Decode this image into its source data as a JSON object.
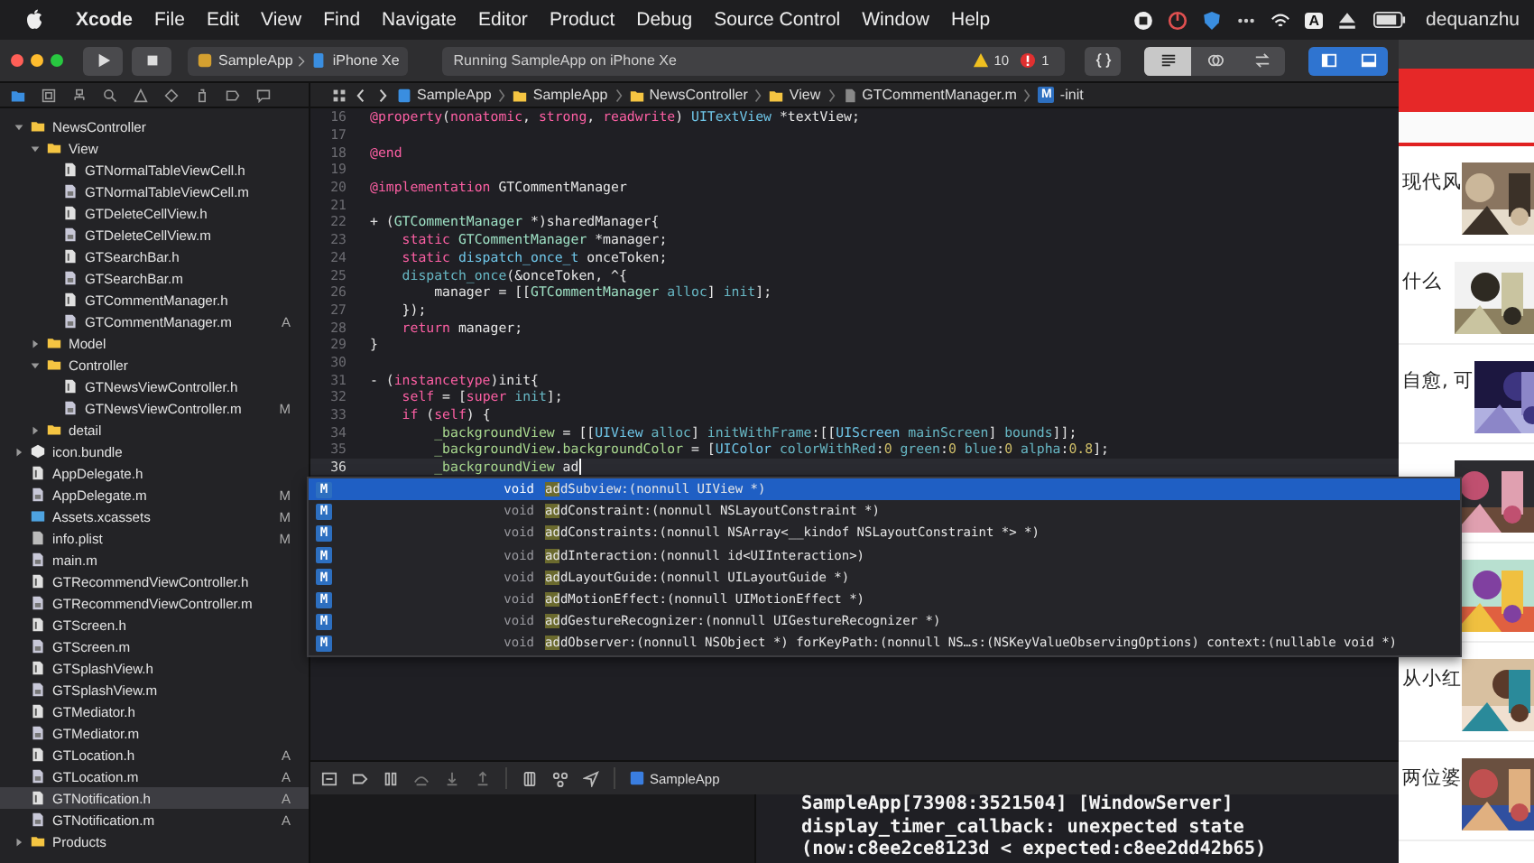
{
  "menu_bar": {
    "app": "Xcode",
    "items": [
      "File",
      "Edit",
      "View",
      "Find",
      "Navigate",
      "Editor",
      "Product",
      "Debug",
      "Source Control",
      "Window",
      "Help"
    ],
    "input_source": "A",
    "user": "dequanzhu"
  },
  "toolbar": {
    "scheme": "SampleApp",
    "device": "iPhone Xe",
    "activity": "Running SampleApp on iPhone Xe",
    "warnings": "10",
    "errors": "1"
  },
  "jump_bar": [
    {
      "kind": "project",
      "label": "SampleApp"
    },
    {
      "kind": "folder",
      "label": "SampleApp"
    },
    {
      "kind": "folder",
      "label": "NewsController"
    },
    {
      "kind": "folder",
      "label": "View"
    },
    {
      "kind": "file",
      "label": "GTCommentManager.m"
    },
    {
      "kind": "method",
      "badge": "M",
      "label": "-init"
    }
  ],
  "navigator": {
    "items": [
      {
        "name": "NewsController",
        "kind": "folder",
        "expanded": true,
        "selected": false,
        "children": [
          {
            "name": "View",
            "kind": "folder",
            "expanded": true,
            "selected": false,
            "children": [
              {
                "name": "GTNormalTableViewCell.h",
                "kind": "h",
                "selected": false
              },
              {
                "name": "GTNormalTableViewCell.m",
                "kind": "m",
                "selected": false
              },
              {
                "name": "GTDeleteCellView.h",
                "kind": "h",
                "selected": false
              },
              {
                "name": "GTDeleteCellView.m",
                "kind": "m",
                "selected": false
              },
              {
                "name": "GTSearchBar.h",
                "kind": "h",
                "selected": false
              },
              {
                "name": "GTSearchBar.m",
                "kind": "m",
                "selected": false
              },
              {
                "name": "GTCommentManager.h",
                "kind": "h",
                "selected": false
              },
              {
                "name": "GTCommentManager.m",
                "kind": "m",
                "status": "A",
                "selected": false
              }
            ]
          },
          {
            "name": "Model",
            "kind": "folder",
            "expanded": false,
            "selected": false
          },
          {
            "name": "Controller",
            "kind": "folder",
            "expanded": true,
            "selected": false,
            "children": [
              {
                "name": "GTNewsViewController.h",
                "kind": "h",
                "selected": false
              },
              {
                "name": "GTNewsViewController.m",
                "kind": "m",
                "status": "M",
                "selected": false
              }
            ]
          },
          {
            "name": "detail",
            "kind": "folder",
            "expanded": false,
            "selected": false
          }
        ]
      },
      {
        "name": "icon.bundle",
        "kind": "bundle",
        "expanded": false,
        "selected": false
      },
      {
        "name": "AppDelegate.h",
        "kind": "h",
        "selected": false
      },
      {
        "name": "AppDelegate.m",
        "kind": "m",
        "status": "M",
        "selected": false
      },
      {
        "name": "Assets.xcassets",
        "kind": "assets",
        "status": "M",
        "selected": false
      },
      {
        "name": "info.plist",
        "kind": "plist",
        "status": "M",
        "selected": false
      },
      {
        "name": "main.m",
        "kind": "m",
        "selected": false
      },
      {
        "name": "GTRecommendViewController.h",
        "kind": "h",
        "selected": false
      },
      {
        "name": "GTRecommendViewController.m",
        "kind": "m",
        "selected": false
      },
      {
        "name": "GTScreen.h",
        "kind": "h",
        "selected": false
      },
      {
        "name": "GTScreen.m",
        "kind": "m",
        "selected": false
      },
      {
        "name": "GTSplashView.h",
        "kind": "h",
        "selected": false
      },
      {
        "name": "GTSplashView.m",
        "kind": "m",
        "selected": false
      },
      {
        "name": "GTMediator.h",
        "kind": "h",
        "selected": false
      },
      {
        "name": "GTMediator.m",
        "kind": "m",
        "selected": false
      },
      {
        "name": "GTLocation.h",
        "kind": "h",
        "status": "A",
        "selected": false
      },
      {
        "name": "GTLocation.m",
        "kind": "m",
        "status": "A",
        "selected": false
      },
      {
        "name": "GTNotification.h",
        "kind": "h",
        "status": "A",
        "selected": true
      },
      {
        "name": "GTNotification.m",
        "kind": "m",
        "status": "A",
        "selected": false
      },
      {
        "name": "Products",
        "kind": "folder",
        "expanded": false,
        "selected": false
      }
    ]
  },
  "editor": {
    "lines": [
      {
        "number": "16",
        "current": false,
        "tokens": [
          {
            "kind": "kw",
            "text": "@property"
          },
          {
            "kind": "plain",
            "text": "("
          },
          {
            "kind": "kw",
            "text": "nonatomic"
          },
          {
            "kind": "plain",
            "text": ", "
          },
          {
            "kind": "kw",
            "text": "strong"
          },
          {
            "kind": "plain",
            "text": ", "
          },
          {
            "kind": "kw",
            "text": "readwrite"
          },
          {
            "kind": "plain",
            "text": ") "
          },
          {
            "kind": "sys",
            "text": "UITextView"
          },
          {
            "kind": "plain",
            "text": " *textView;"
          }
        ]
      },
      {
        "number": "17",
        "current": false
      },
      {
        "number": "18",
        "current": false,
        "tokens": [
          {
            "kind": "kw",
            "text": "@end"
          }
        ]
      },
      {
        "number": "19",
        "current": false
      },
      {
        "number": "20",
        "current": false,
        "tokens": [
          {
            "kind": "kw",
            "text": "@implementation"
          },
          {
            "kind": "plain",
            "text": " GTCommentManager"
          }
        ]
      },
      {
        "number": "21",
        "current": false
      },
      {
        "number": "22",
        "current": false,
        "tokens": [
          {
            "kind": "plain",
            "text": "+ ("
          },
          {
            "kind": "cls",
            "text": "GTCommentManager"
          },
          {
            "kind": "plain",
            "text": " *)sharedManager{"
          }
        ]
      },
      {
        "number": "23",
        "current": false,
        "tokens": [
          {
            "kind": "kw",
            "text": "    static "
          },
          {
            "kind": "cls",
            "text": "GTCommentManager"
          },
          {
            "kind": "plain",
            "text": " *manager;"
          }
        ]
      },
      {
        "number": "24",
        "current": false,
        "tokens": [
          {
            "kind": "kw",
            "text": "    static "
          },
          {
            "kind": "sys",
            "text": "dispatch_once_t"
          },
          {
            "kind": "plain",
            "text": " onceToken;"
          }
        ]
      },
      {
        "number": "25",
        "current": false,
        "tokens": [
          {
            "kind": "fn",
            "text": "    dispatch_once"
          },
          {
            "kind": "plain",
            "text": "(&onceToken, ^{"
          }
        ]
      },
      {
        "number": "26",
        "current": false,
        "tokens": [
          {
            "kind": "plain",
            "text": "        manager = [["
          },
          {
            "kind": "cls",
            "text": "GTCommentManager"
          },
          {
            "kind": "fn",
            "text": " alloc"
          },
          {
            "kind": "plain",
            "text": "] "
          },
          {
            "kind": "fn",
            "text": "init"
          },
          {
            "kind": "plain",
            "text": "];"
          }
        ]
      },
      {
        "number": "27",
        "current": false,
        "tokens": [
          {
            "kind": "plain",
            "text": "    });"
          }
        ]
      },
      {
        "number": "28",
        "current": false,
        "tokens": [
          {
            "kind": "kw",
            "text": "    return"
          },
          {
            "kind": "plain",
            "text": " manager;"
          }
        ]
      },
      {
        "number": "29",
        "current": false,
        "tokens": [
          {
            "kind": "plain",
            "text": "}"
          }
        ]
      },
      {
        "number": "30",
        "current": false
      },
      {
        "number": "31",
        "current": false,
        "tokens": [
          {
            "kind": "plain",
            "text": "- ("
          },
          {
            "kind": "kw",
            "text": "instancetype"
          },
          {
            "kind": "plain",
            "text": ")init{"
          }
        ]
      },
      {
        "number": "32",
        "current": false,
        "tokens": [
          {
            "kind": "kw",
            "text": "    self"
          },
          {
            "kind": "plain",
            "text": " = ["
          },
          {
            "kind": "kw",
            "text": "super"
          },
          {
            "kind": "fn",
            "text": " init"
          },
          {
            "kind": "plain",
            "text": "];"
          }
        ]
      },
      {
        "number": "33",
        "current": false,
        "tokens": [
          {
            "kind": "kw",
            "text": "    if"
          },
          {
            "kind": "plain",
            "text": " ("
          },
          {
            "kind": "kw",
            "text": "self"
          },
          {
            "kind": "plain",
            "text": ") {"
          }
        ]
      },
      {
        "number": "34",
        "current": false,
        "tokens": [
          {
            "kind": "ivar",
            "text": "        _backgroundView"
          },
          {
            "kind": "plain",
            "text": " = [["
          },
          {
            "kind": "sys",
            "text": "UIView"
          },
          {
            "kind": "fn",
            "text": " alloc"
          },
          {
            "kind": "plain",
            "text": "] "
          },
          {
            "kind": "fn",
            "text": "initWithFrame"
          },
          {
            "kind": "plain",
            "text": ":[["
          },
          {
            "kind": "sys",
            "text": "UIScreen"
          },
          {
            "kind": "fn",
            "text": " mainScreen"
          },
          {
            "kind": "plain",
            "text": "] "
          },
          {
            "kind": "fn",
            "text": "bounds"
          },
          {
            "kind": "plain",
            "text": "]];"
          }
        ]
      },
      {
        "number": "35",
        "current": false,
        "tokens": [
          {
            "kind": "ivar",
            "text": "        _backgroundView"
          },
          {
            "kind": "plain",
            "text": "."
          },
          {
            "kind": "ivar",
            "text": "backgroundColor"
          },
          {
            "kind": "plain",
            "text": " = ["
          },
          {
            "kind": "sys",
            "text": "UIColor"
          },
          {
            "kind": "fn",
            "text": " colorWithRed"
          },
          {
            "kind": "plain",
            "text": ":"
          },
          {
            "kind": "num",
            "text": "0"
          },
          {
            "kind": "fn",
            "text": " green"
          },
          {
            "kind": "plain",
            "text": ":"
          },
          {
            "kind": "num",
            "text": "0"
          },
          {
            "kind": "fn",
            "text": " blue"
          },
          {
            "kind": "plain",
            "text": ":"
          },
          {
            "kind": "num",
            "text": "0"
          },
          {
            "kind": "fn",
            "text": " alpha"
          },
          {
            "kind": "plain",
            "text": ":"
          },
          {
            "kind": "num",
            "text": "0.8"
          },
          {
            "kind": "plain",
            "text": "];"
          }
        ]
      },
      {
        "number": "36",
        "current": true,
        "tokens": [
          {
            "kind": "ivar",
            "text": "        _backgroundView"
          },
          {
            "kind": "plain",
            "text": " ad"
          }
        ]
      }
    ]
  },
  "completions": [
    {
      "badge": "M",
      "type": "void",
      "match": "ad",
      "rest": "dSubview:(nonnull UIView *)",
      "selected": true
    },
    {
      "badge": "M",
      "type": "void",
      "match": "ad",
      "rest": "dConstraint:(nonnull NSLayoutConstraint *)",
      "selected": false
    },
    {
      "badge": "M",
      "type": "void",
      "match": "ad",
      "rest": "dConstraints:(nonnull NSArray<__kindof NSLayoutConstraint *> *)",
      "selected": false
    },
    {
      "badge": "M",
      "type": "void",
      "match": "ad",
      "rest": "dInteraction:(nonnull id<UIInteraction>)",
      "selected": false
    },
    {
      "badge": "M",
      "type": "void",
      "match": "ad",
      "rest": "dLayoutGuide:(nonnull UILayoutGuide *)",
      "selected": false
    },
    {
      "badge": "M",
      "type": "void",
      "match": "ad",
      "rest": "dMotionEffect:(nonnull UIMotionEffect *)",
      "selected": false
    },
    {
      "badge": "M",
      "type": "void",
      "match": "ad",
      "rest": "dGestureRecognizer:(nonnull UIGestureRecognizer *)",
      "selected": false
    },
    {
      "badge": "M",
      "type": "void",
      "match": "ad",
      "rest": "dObserver:(nonnull NSObject *) forKeyPath:(nonnull NS…s:(NSKeyValueObservingOptions) context:(nullable void *)",
      "selected": false
    }
  ],
  "debug_bar": {
    "target": "SampleApp"
  },
  "console": {
    "lines": [
      "SampleApp[73908:3521504] [WindowServer]",
      "display_timer_callback: unexpected state",
      "(now:c8ee2ce8123d < expected:c8ee2dd42b65)"
    ]
  },
  "simulator": {
    "rows": [
      {
        "title": "现代风",
        "kind": "picture"
      },
      {
        "title": "什么",
        "kind": "picture"
      },
      {
        "title": "自愈, 可",
        "kind": "picture"
      },
      {
        "kind": "picture"
      },
      {
        "kind": "picture"
      },
      {
        "title": "从小红",
        "kind": "picture"
      },
      {
        "title": "两位婆",
        "kind": "picture"
      }
    ]
  }
}
